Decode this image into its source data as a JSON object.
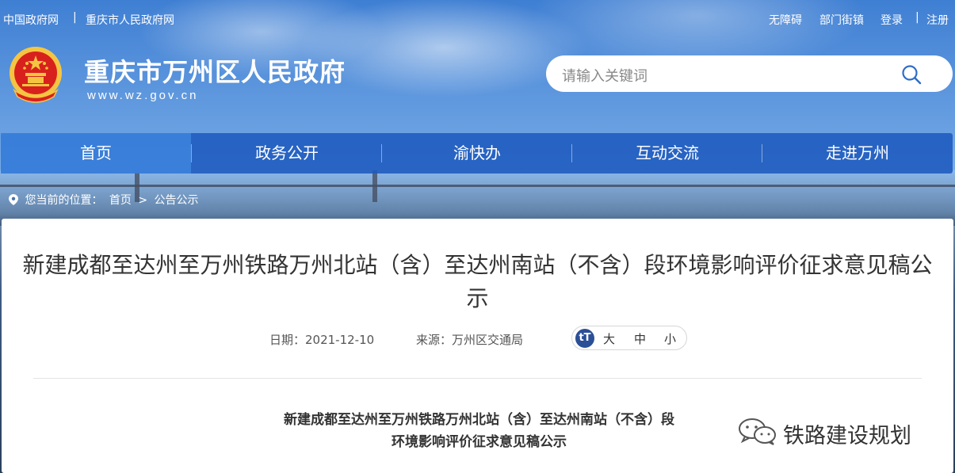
{
  "top_links": {
    "left": [
      "中国政府网",
      "重庆市人民政府网"
    ],
    "right": [
      "无障碍",
      "部门街镇",
      "登录",
      "注册"
    ]
  },
  "site": {
    "title": "重庆市万州区人民政府",
    "url": "www.wz.gov.cn"
  },
  "search": {
    "placeholder": "请输入关键词"
  },
  "nav": {
    "items": [
      "首页",
      "政务公开",
      "渝快办",
      "互动交流",
      "走进万州"
    ],
    "active": "首页"
  },
  "breadcrumb": {
    "prefix": "您当前的位置：",
    "items": [
      "首页",
      ">",
      "公告公示"
    ]
  },
  "article": {
    "title": "新建成都至达州至万州铁路万州北站（含）至达州南站（不含）段环境影响评价征求意见稿公示",
    "date": "日期：2021-12-10",
    "source": "来源：万州区交通局",
    "font_size": {
      "icon": "tT",
      "options": [
        "大",
        "中",
        "小"
      ]
    },
    "body_title_line1": "新建成都至达州至万州铁路万州北站（含）至达州南站（不含）段",
    "body_title_line2": "环境影响评价征求意见稿公示"
  },
  "watermark": {
    "text": "铁路建设规划"
  },
  "colors": {
    "nav_bg": "#1e5abe",
    "nav_active": "#3c82dc",
    "fontsize_icon": "#2b4f97",
    "emblem_red": "#d8211c",
    "emblem_gold": "#f5c542"
  }
}
